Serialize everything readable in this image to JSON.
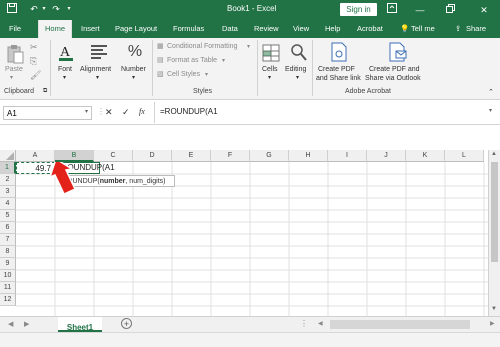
{
  "titlebar": {
    "doc_title": "Book1  -  Excel",
    "signin_label": "Sign in"
  },
  "tabs": [
    {
      "label": "File"
    },
    {
      "label": "Home"
    },
    {
      "label": "Insert"
    },
    {
      "label": "Page Layout"
    },
    {
      "label": "Formulas"
    },
    {
      "label": "Data"
    },
    {
      "label": "Review"
    },
    {
      "label": "View"
    },
    {
      "label": "Help"
    },
    {
      "label": "Acrobat"
    },
    {
      "label": "Tell me"
    },
    {
      "label": "Share"
    }
  ],
  "ribbon": {
    "paste": "Paste",
    "clipboard": "Clipboard",
    "font": "Font",
    "alignment": "Alignment",
    "number": "Number",
    "conditional_formatting": "Conditional Formatting",
    "format_as_table": "Format as Table",
    "cell_styles": "Cell Styles",
    "styles": "Styles",
    "cells": "Cells",
    "editing": "Editing",
    "create_pdf_1": "Create PDF",
    "create_pdf_2": "and Share link",
    "create_pdf_outlook_1": "Create PDF and",
    "create_pdf_outlook_2": "Share via Outlook",
    "adobe_acrobat": "Adobe Acrobat"
  },
  "formula_bar": {
    "name_box": "A1",
    "formula": "=ROUNDUP(A1"
  },
  "grid": {
    "columns": [
      "A",
      "B",
      "C",
      "D",
      "E",
      "F",
      "G",
      "H",
      "I",
      "J",
      "K",
      "L"
    ],
    "rows": [
      "1",
      "2",
      "3",
      "4",
      "5",
      "6",
      "7",
      "8",
      "9",
      "10",
      "11",
      "12"
    ],
    "cell_a1": "49.7",
    "cell_b1_edit": "=ROUNDUP(A1",
    "tooltip_fn": "ROUNDUP(",
    "tooltip_args": "number",
    "tooltip_rest": ", num_digits)"
  },
  "sheets": [
    {
      "label": "Sheet1"
    }
  ],
  "colors": {
    "excel_green": "#217346",
    "arrow_red": "#e32219"
  }
}
